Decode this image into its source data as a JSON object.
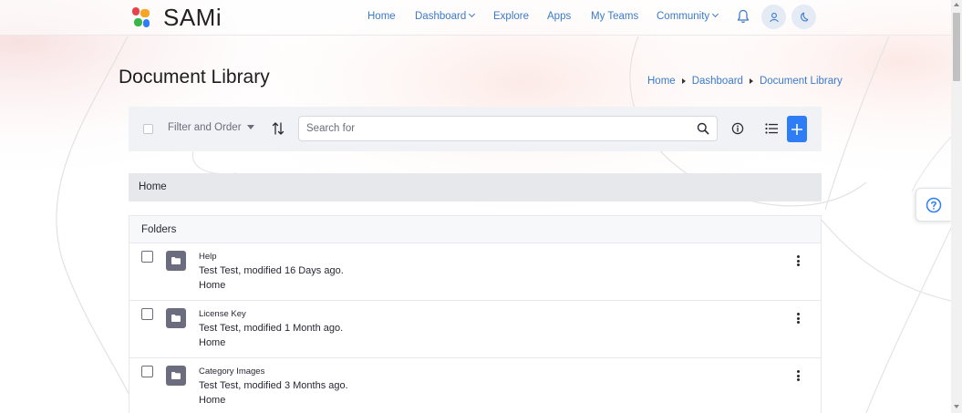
{
  "app": {
    "logo_text": "SAMi"
  },
  "nav": {
    "links": [
      {
        "label": "Home",
        "has_caret": false
      },
      {
        "label": "Dashboard",
        "has_caret": true
      },
      {
        "label": "Explore",
        "has_caret": false
      },
      {
        "label": "Apps",
        "has_caret": false
      },
      {
        "label": "My Teams",
        "has_caret": false
      },
      {
        "label": "Community",
        "has_caret": true
      }
    ],
    "icons": [
      "bell-icon",
      "user-icon",
      "moon-icon"
    ]
  },
  "page": {
    "title": "Document Library",
    "breadcrumb": [
      "Home",
      "Dashboard",
      "Document Library"
    ]
  },
  "toolbar": {
    "filter_label": "Filter and Order",
    "search_placeholder": "Search for",
    "icons": [
      "sort-icon",
      "search-icon",
      "info-icon",
      "list-view-icon",
      "plus-icon"
    ]
  },
  "current_folder": "Home",
  "folders": {
    "header": "Folders",
    "items": [
      {
        "title": "Help",
        "meta": "Test Test, modified 16 Days ago.",
        "path": "Home"
      },
      {
        "title": "License Key",
        "meta": "Test Test, modified 1 Month ago.",
        "path": "Home"
      },
      {
        "title": "Category Images",
        "meta": "Test Test, modified 3 Months ago.",
        "path": "Home"
      }
    ]
  },
  "colors": {
    "accent": "#2e7cf6",
    "link": "#3b7ac9",
    "logo_red": "#e8414c",
    "logo_orange": "#f5a623",
    "logo_green": "#39b54a",
    "logo_blue": "#2e7cf6"
  }
}
